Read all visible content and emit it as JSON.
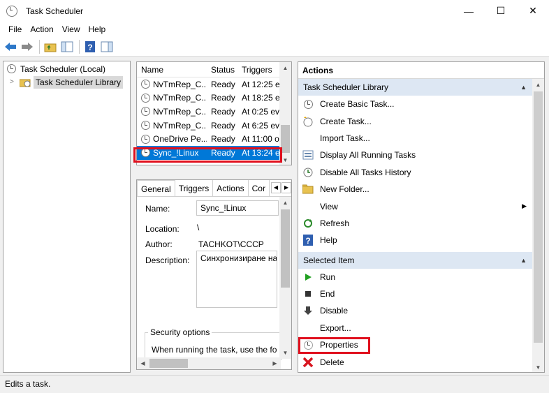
{
  "window": {
    "title": "Task Scheduler",
    "minimize": "—",
    "maximize": "☐",
    "close": "✕"
  },
  "menu": [
    "File",
    "Action",
    "View",
    "Help"
  ],
  "tree": {
    "root": "Task Scheduler (Local)",
    "library": "Task Scheduler Library"
  },
  "task_list": {
    "columns": [
      "Name",
      "Status",
      "Triggers"
    ],
    "rows": [
      {
        "name": "NvTmRep_C...",
        "status": "Ready",
        "trigger": "At 12:25 e"
      },
      {
        "name": "NvTmRep_C...",
        "status": "Ready",
        "trigger": "At 18:25 e"
      },
      {
        "name": "NvTmRep_C...",
        "status": "Ready",
        "trigger": "At 0:25 ev"
      },
      {
        "name": "NvTmRep_C...",
        "status": "Ready",
        "trigger": "At 6:25 ev"
      },
      {
        "name": "OneDrive Pe...",
        "status": "Ready",
        "trigger": "At 11:00 o"
      },
      {
        "name": "Sync_!Linux",
        "status": "Ready",
        "trigger": "At 13:24 e"
      }
    ],
    "selected_index": 5
  },
  "details": {
    "tabs": [
      "General",
      "Triggers",
      "Actions",
      "Cor"
    ],
    "name_label": "Name:",
    "name_value": "Sync_!Linux",
    "location_label": "Location:",
    "location_value": "\\",
    "author_label": "Author:",
    "author_value": "TACHKOT\\CCCP",
    "description_label": "Description:",
    "description_value": "Синхронизиране на",
    "security_label": "Security options",
    "security_text": "When running the task, use the fo"
  },
  "actions": {
    "title": "Actions",
    "library_section": "Task Scheduler Library",
    "library_items": [
      {
        "label": "Create Basic Task...",
        "icon": "clock-wizard-icon"
      },
      {
        "label": "Create Task...",
        "icon": "clock-new-icon"
      },
      {
        "label": "Import Task...",
        "icon": "none"
      },
      {
        "label": "Display All Running Tasks",
        "icon": "running-tasks-icon"
      },
      {
        "label": "Disable All Tasks History",
        "icon": "history-icon"
      },
      {
        "label": "New Folder...",
        "icon": "folder-icon"
      },
      {
        "label": "View",
        "icon": "none"
      },
      {
        "label": "Refresh",
        "icon": "refresh-icon"
      },
      {
        "label": "Help",
        "icon": "help-icon"
      }
    ],
    "selected_section": "Selected Item",
    "selected_items": [
      {
        "label": "Run",
        "icon": "run-icon"
      },
      {
        "label": "End",
        "icon": "end-icon"
      },
      {
        "label": "Disable",
        "icon": "disable-icon"
      },
      {
        "label": "Export...",
        "icon": "none"
      },
      {
        "label": "Properties",
        "icon": "properties-icon"
      },
      {
        "label": "Delete",
        "icon": "delete-icon"
      }
    ]
  },
  "status": "Edits a task.",
  "colors": {
    "selection": "#0078d7",
    "highlight": "#e0101e",
    "section_bg": "#dde7f3"
  }
}
